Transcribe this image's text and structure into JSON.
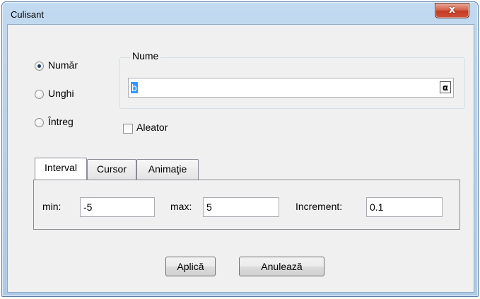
{
  "window": {
    "title": "Culisant",
    "close_glyph": "x"
  },
  "type_options": [
    {
      "label": "Număr",
      "checked": true
    },
    {
      "label": "Unghi",
      "checked": false
    },
    {
      "label": "Întreg",
      "checked": false
    }
  ],
  "name_group": {
    "title": "Nume",
    "value": "b",
    "symbol_button": "α"
  },
  "random_checkbox": {
    "label": "Aleator",
    "checked": false
  },
  "tabs": [
    {
      "label": "Interval",
      "active": true
    },
    {
      "label": "Cursor",
      "active": false
    },
    {
      "label": "Animaţie",
      "active": false
    }
  ],
  "interval": {
    "min_label": "min:",
    "min_value": "-5",
    "max_label": "max:",
    "max_value": "5",
    "increment_label": "Increment:",
    "increment_value": "0.1"
  },
  "buttons": {
    "apply": "Aplică",
    "cancel": "Anulează"
  },
  "icons": {
    "close": "close-icon",
    "alpha": "alpha-icon"
  }
}
